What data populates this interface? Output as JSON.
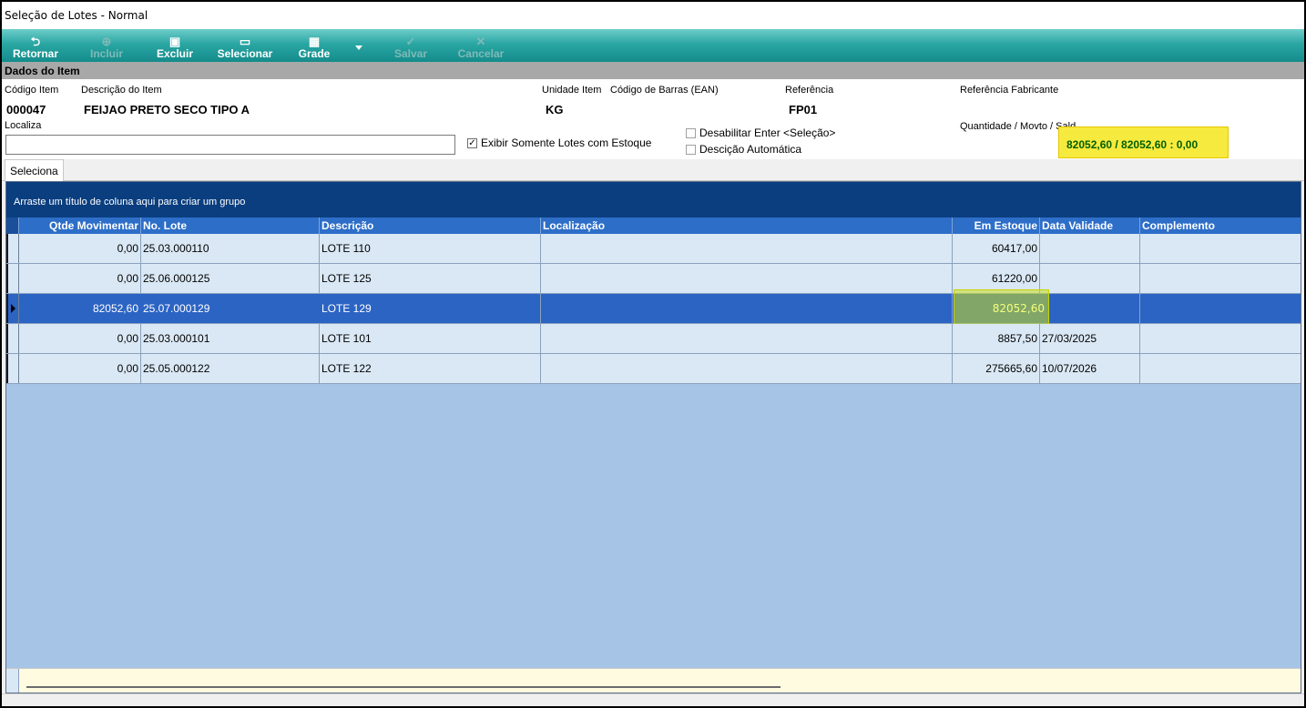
{
  "window": {
    "title": "Seleção de Lotes - Normal"
  },
  "toolbar": {
    "buttons": [
      {
        "label": "Retornar",
        "icon": "return-arrow-icon",
        "enabled": true
      },
      {
        "label": "Incluir",
        "icon": "plus-icon",
        "enabled": false
      },
      {
        "label": "Excluir",
        "icon": "trash-icon",
        "enabled": true
      },
      {
        "label": "Selecionar",
        "icon": "select-grid-icon",
        "enabled": true
      },
      {
        "label": "Grade",
        "icon": "grid-icon",
        "enabled": true
      },
      {
        "label": "Salvar",
        "icon": "checkmark-icon",
        "enabled": false
      },
      {
        "label": "Cancelar",
        "icon": "cancel-x-icon",
        "enabled": false
      }
    ]
  },
  "section": {
    "title": "Dados do Item"
  },
  "item": {
    "code_label": "Código Item",
    "code": "000047",
    "description_label": "Descrição do Item",
    "description": "FEIJAO PRETO SECO TIPO A",
    "unit_label": "Unidade Item",
    "unit": "KG",
    "barcode_label": "Código de Barras (EAN)",
    "barcode": "",
    "reference_label": "Referência",
    "reference": "FP01",
    "manufacturer_ref_label": "Referência Fabricante",
    "manufacturer_ref": ""
  },
  "search": {
    "label": "Localiza",
    "value": ""
  },
  "options": {
    "only_with_stock": {
      "label": "Exibir Somente Lotes com Estoque",
      "checked": true
    },
    "disable_enter": {
      "label": "Desabilitar Enter <Seleção>",
      "checked": false
    },
    "auto_description": {
      "label": "Descição Automática",
      "checked": false
    }
  },
  "quantity": {
    "label": "Quantidade / Movto / Sald",
    "value": "82052,60 / 82052,60 : 0,00"
  },
  "tabs": [
    {
      "label": "Seleciona",
      "active": true
    }
  ],
  "grid": {
    "group_hint": "Arraste um título de coluna aqui para criar um grupo",
    "columns": [
      "Qtde Movimentar",
      "No. Lote",
      "Descrição",
      "Localização",
      "Em Estoque",
      "Data Validade",
      "Complemento"
    ],
    "rows": [
      {
        "qtde": "0,00",
        "lote": "25.03.000110",
        "descricao": "LOTE 110",
        "localizacao": "",
        "estoque": "60417,00",
        "validade": "",
        "complemento": "",
        "selected": false
      },
      {
        "qtde": "0,00",
        "lote": "25.06.000125",
        "descricao": "LOTE 125",
        "localizacao": "",
        "estoque": "61220,00",
        "validade": "",
        "complemento": "",
        "selected": false
      },
      {
        "qtde": "82052,60",
        "lote": "25.07.000129",
        "descricao": "LOTE 129",
        "localizacao": "",
        "estoque": "82052,60",
        "validade": "",
        "complemento": "",
        "selected": true
      },
      {
        "qtde": "0,00",
        "lote": "25.03.000101",
        "descricao": "LOTE 101",
        "localizacao": "",
        "estoque": "8857,50",
        "validade": "27/03/2025",
        "complemento": "",
        "selected": false
      },
      {
        "qtde": "0,00",
        "lote": "25.05.000122",
        "descricao": "LOTE 122",
        "localizacao": "",
        "estoque": "275665,60",
        "validade": "10/07/2026",
        "complemento": "",
        "selected": false
      }
    ]
  },
  "colors": {
    "toolbar": "#2aa6a3",
    "grid_header": "#2d6ec8",
    "group_panel": "#0a3e7f",
    "selected_row": "#2c64c4",
    "highlight": "#f7ea3e"
  }
}
